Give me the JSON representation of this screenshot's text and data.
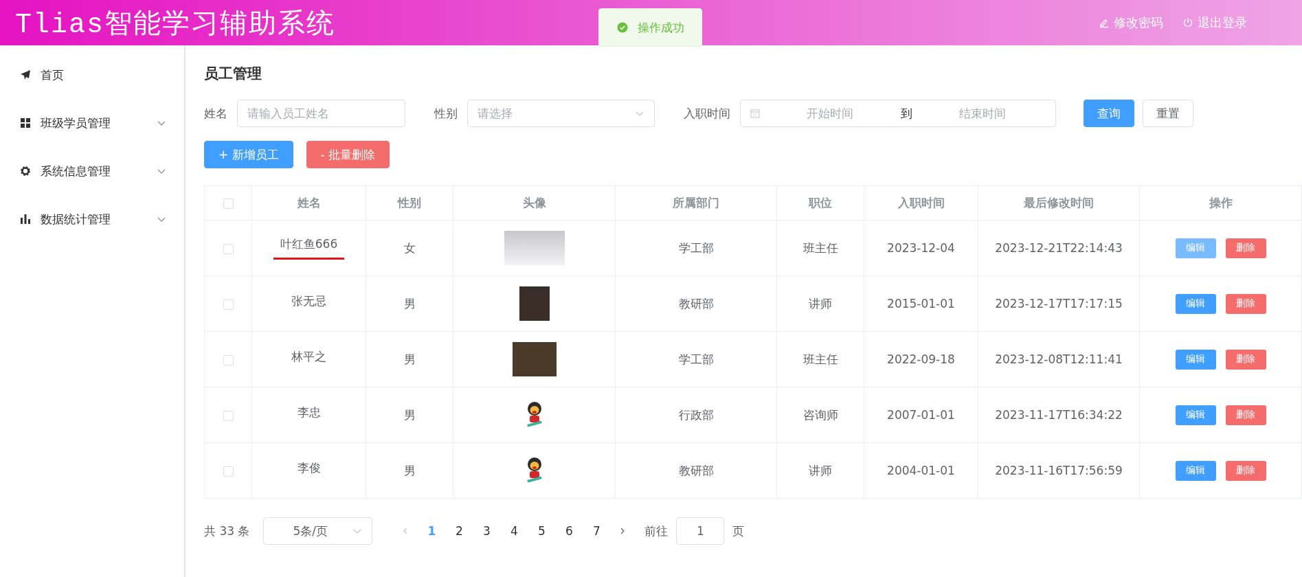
{
  "header": {
    "title": "Tlias智能学习辅助系统",
    "actions": [
      {
        "kind": "password",
        "label": "修改密码"
      },
      {
        "kind": "logout",
        "label": "退出登录"
      }
    ]
  },
  "toast": {
    "kind": "success",
    "message": "操作成功"
  },
  "sidebar": {
    "items": [
      {
        "label": "首页",
        "expandable": false
      },
      {
        "label": "班级学员管理",
        "expandable": true
      },
      {
        "label": "系统信息管理",
        "expandable": true
      },
      {
        "label": "数据统计管理",
        "expandable": true
      }
    ]
  },
  "page_title": "员工管理",
  "filters": {
    "name": {
      "label": "姓名",
      "placeholder": "请输入员工姓名"
    },
    "gender": {
      "label": "性别",
      "placeholder": "请选择"
    },
    "date": {
      "label": "入职时间",
      "start_placeholder": "开始时间",
      "separator": "到",
      "end_placeholder": "结束时间"
    },
    "buttons": [
      {
        "kind": "primary",
        "label": "查询"
      },
      {
        "kind": "plain",
        "label": "重置"
      }
    ]
  },
  "actions": [
    {
      "kind": "primary",
      "label": "+ 新增员工"
    },
    {
      "kind": "danger",
      "label": "- 批量删除"
    }
  ],
  "table": {
    "all_checked": false,
    "columns": [
      "姓名",
      "性别",
      "头像",
      "所属部门",
      "职位",
      "入职时间",
      "最后修改时间",
      "操作"
    ],
    "rows": [
      {
        "checked": false,
        "name": "叶红鱼666",
        "name_underlined": true,
        "gender": "女",
        "avatar": {
          "kind": "gray"
        },
        "department": "学工部",
        "position": "班主任",
        "entry_date": "2023-12-04",
        "update_time": "2023-12-21T22:14:43",
        "edit": {
          "label": "编辑",
          "hovered": true
        },
        "delete": "删除"
      },
      {
        "checked": false,
        "name": "张无忌",
        "name_underlined": false,
        "gender": "男",
        "avatar": {
          "kind": "portrait"
        },
        "department": "教研部",
        "position": "讲师",
        "entry_date": "2015-01-01",
        "update_time": "2023-12-17T17:17:15",
        "edit": {
          "label": "编辑",
          "hovered": false
        },
        "delete": "删除"
      },
      {
        "checked": false,
        "name": "林平之",
        "name_underlined": false,
        "gender": "男",
        "avatar": {
          "kind": "banner"
        },
        "department": "学工部",
        "position": "班主任",
        "entry_date": "2022-09-18",
        "update_time": "2023-12-08T12:11:41",
        "edit": {
          "label": "编辑",
          "hovered": false
        },
        "delete": "删除"
      },
      {
        "checked": false,
        "name": "李忠",
        "name_underlined": false,
        "gender": "男",
        "avatar": {
          "kind": "cartoon"
        },
        "department": "行政部",
        "position": "咨询师",
        "entry_date": "2007-01-01",
        "update_time": "2023-11-17T16:34:22",
        "edit": {
          "label": "编辑",
          "hovered": false
        },
        "delete": "删除"
      },
      {
        "checked": false,
        "name": "李俊",
        "name_underlined": false,
        "gender": "男",
        "avatar": {
          "kind": "cartoon"
        },
        "department": "教研部",
        "position": "讲师",
        "entry_date": "2004-01-01",
        "update_time": "2023-11-16T17:56:59",
        "edit": {
          "label": "编辑",
          "hovered": false
        },
        "delete": "删除"
      }
    ]
  },
  "pagination": {
    "total": "共 33 条",
    "page_size": "5条/页",
    "pages": [
      {
        "label": "1",
        "selected": true
      },
      {
        "label": "2",
        "selected": false
      },
      {
        "label": "3",
        "selected": false
      },
      {
        "label": "4",
        "selected": false
      },
      {
        "label": "5",
        "selected": false
      },
      {
        "label": "6",
        "selected": false
      },
      {
        "label": "7",
        "selected": false
      }
    ],
    "goto_label": "前往",
    "goto_value": "1",
    "goto_suffix": "页"
  }
}
